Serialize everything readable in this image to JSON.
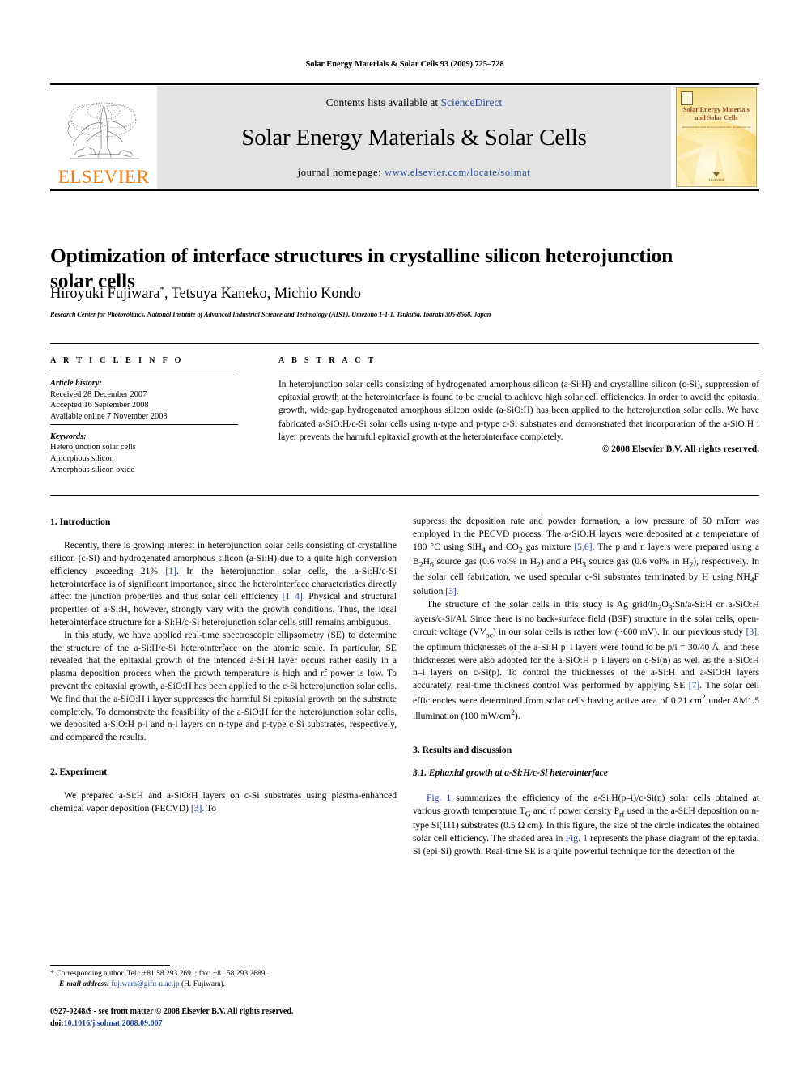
{
  "running_head": "Solar Energy Materials & Solar Cells 93 (2009) 725–728",
  "header": {
    "contents_prefix": "Contents lists available at ",
    "sciencedirect": "ScienceDirect",
    "journal_name": "Solar Energy Materials & Solar Cells",
    "homepage_prefix": "journal homepage: ",
    "homepage_url": "www.elsevier.com/locate/solmat",
    "publisher": "ELSEVIER",
    "accent_orange": "#F07F17",
    "link_blue": "#2b4f9e",
    "band_gray": "#e3e3e3"
  },
  "cover": {
    "title_line1": "Solar Energy Materials",
    "title_line2": "and Solar Cells",
    "subtitle": "an international journal devoted to photovoltaic, photothermal and photochemical solar energy conversion",
    "footer": "ELSEVIER"
  },
  "article": {
    "title": "Optimization of interface structures in crystalline silicon heterojunction solar cells",
    "authors": "Hiroyuki Fujiwara",
    "authors_rest": ", Tetsuya Kaneko, Michio Kondo",
    "corresponding_mark": "*",
    "affiliation": "Research Center for Photovoltaics, National Institute of Advanced Industrial Science and Technology (AIST), Umezono 1-1-1, Tsukuba, Ibaraki 305-8568, Japan"
  },
  "info": {
    "heading": "A R T I C L E   I N F O",
    "history_label": "Article history:",
    "received": "Received 28 December 2007",
    "accepted": "Accepted 16 September 2008",
    "available": "Available online 7 November 2008",
    "keywords_label": "Keywords:",
    "keywords": [
      "Heterojunction solar cells",
      "Amorphous silicon",
      "Amorphous silicon oxide"
    ]
  },
  "abstract": {
    "heading": "A B S T R A C T",
    "text": "In heterojunction solar cells consisting of hydrogenated amorphous silicon (a-Si:H) and crystalline silicon (c-Si), suppression of epitaxial growth at the heterointerface is found to be crucial to achieve high solar cell efficiencies. In order to avoid the epitaxial growth, wide-gap hydrogenated amorphous silicon oxide (a-SiO:H) has been applied to the heterojunction solar cells. We have fabricated a-SiO:H/c-Si solar cells using n-type and p-type c-Si substrates and demonstrated that incorporation of the a-SiO:H i layer prevents the harmful epitaxial growth at the heterointerface completely.",
    "copyright": "© 2008 Elsevier B.V. All rights reserved."
  },
  "sections": {
    "introduction_heading": "1.  Introduction",
    "intro_p1_a": "Recently, there is growing interest in heterojunction solar cells consisting of crystalline silicon (c-Si) and hydrogenated amorphous silicon (a-Si:H) due to a quite high conversion efficiency exceeding 21% ",
    "intro_ref1": "[1]",
    "intro_p1_b": ". In the heterojunction solar cells, the a-Si:H/c-Si heterointerface is of significant importance, since the heterointerface characteristics directly affect the junction properties and thus solar cell efficiency ",
    "intro_ref2": "[1–4]",
    "intro_p1_c": ". Physical and structural properties of a-Si:H, however, strongly vary with the growth conditions. Thus, the ideal heterointerface structure for a-Si:H/c-Si heterojunction solar cells still remains ambiguous.",
    "intro_p2": "In this study, we have applied real-time spectroscopic ellipsometry (SE) to determine the structure of the a-Si:H/c-Si heterointerface on the atomic scale. In particular, SE revealed that the epitaxial growth of the intended a-Si:H layer occurs rather easily in a plasma deposition process when the growth temperature is high and rf power is low. To prevent the epitaxial growth, a-SiO:H has been applied to the c-Si heterojunction solar cells. We find that the a-SiO:H i layer suppresses the harmful Si epitaxial growth on the substrate completely. To demonstrate the feasibility of the a-SiO:H for the heterojunction solar cells, we deposited a-SiO:H p-i and n-i layers on n-type and p-type c-Si substrates, respectively, and compared the results.",
    "experiment_heading": "2.  Experiment",
    "exp_p1_a": "We prepared a-Si:H and a-SiO:H layers on c-Si substrates using plasma-enhanced chemical vapor deposition (PECVD) ",
    "exp_ref3": "[3]",
    "exp_p1_b": ". To",
    "exp_p1_cont_a": "suppress the deposition rate and powder formation, a low pressure of 50 mTorr was employed in the PECVD process. The a-SiO:H layers were deposited at a temperature of 180 °C using SiH",
    "exp_p1_cont_b": " and CO",
    "exp_p1_cont_c": " gas mixture ",
    "exp_ref56": "[5,6]",
    "exp_p1_cont_d": ". The p and n layers were prepared using a B",
    "exp_p1_cont_e": "H",
    "exp_p1_cont_f": " source gas (0.6 vol% in H",
    "exp_p1_cont_g": ") and a PH",
    "exp_p1_cont_h": " source gas (0.6 vol% in H",
    "exp_p1_cont_i": "), respectively. In the solar cell fabrication, we used specular c-Si substrates terminated by H using NH",
    "exp_p1_cont_j": "F solution ",
    "exp_ref3b": "[3]",
    "exp_p1_cont_k": ".",
    "exp_p2_a": "The structure of the solar cells in this study is Ag grid/In",
    "exp_p2_b": "O",
    "exp_p2_c": ":Sn/a-Si:H or a-SiO:H layers/c-Si/Al. Since there is no back-surface field (BSF) structure in the solar cells, open-circuit voltage (V",
    "exp_p2_voc": "oc",
    "exp_p2_d": ") in our solar cells is rather low (~600 mV). In our previous study ",
    "exp_ref3c": "[3]",
    "exp_p2_e": ", the optimum thicknesses of the a-Si:H p–i layers were found to be p/i = 30/40 Å, and these thicknesses were also adopted for the a-SiO:H p–i layers on c-Si(n) as well as the a-SiO:H n–i layers on c-Si(p). To control the thicknesses of the a-Si:H and a-SiO:H layers accurately, real-time thickness control was performed by applying SE ",
    "exp_ref7": "[7]",
    "exp_p2_f": ". The solar cell efficiencies were determined from solar cells having active area of 0.21 cm",
    "exp_p2_sup2": "2",
    "exp_p2_g": " under AM1.5 illumination (100 mW/cm",
    "exp_p2_sup2b": "2",
    "exp_p2_h": ").",
    "results_heading": "3.  Results and discussion",
    "subsection_heading": "3.1.  Epitaxial growth at a-Si:H/c-Si heterointerface",
    "res_p1_fig": "Fig. 1",
    "res_p1_a": " summarizes the efficiency of the a-Si:H(p–i)/c-Si(n) solar cells obtained at various growth temperature T",
    "res_p1_tg": "G",
    "res_p1_b": " and rf power density P",
    "res_p1_prf": "rf",
    "res_p1_c": " used in the a-Si:H deposition on n-type Si(111) substrates (0.5 Ω cm). In this figure, the size of the circle indicates the obtained solar cell efficiency. The shaded area in ",
    "res_p1_fig2": "Fig. 1",
    "res_p1_d": " represents the phase diagram of the epitaxial Si (epi-Si) growth. Real-time SE is a quite powerful technique for the detection of the"
  },
  "footnote": {
    "star": "*",
    "corresponding": " Corresponding author. Tel.: +81 58 293 2691; fax: +81 58 293 2689.",
    "email_label": "E-mail address:",
    "email": "fujiwara@gifu-u.ac.jp",
    "email_owner": " (H. Fujiwara)."
  },
  "imprint": {
    "line1": "0927-0248/$ - see front matter © 2008 Elsevier B.V. All rights reserved.",
    "doi_label": "doi:",
    "doi": "10.1016/j.solmat.2008.09.007"
  }
}
